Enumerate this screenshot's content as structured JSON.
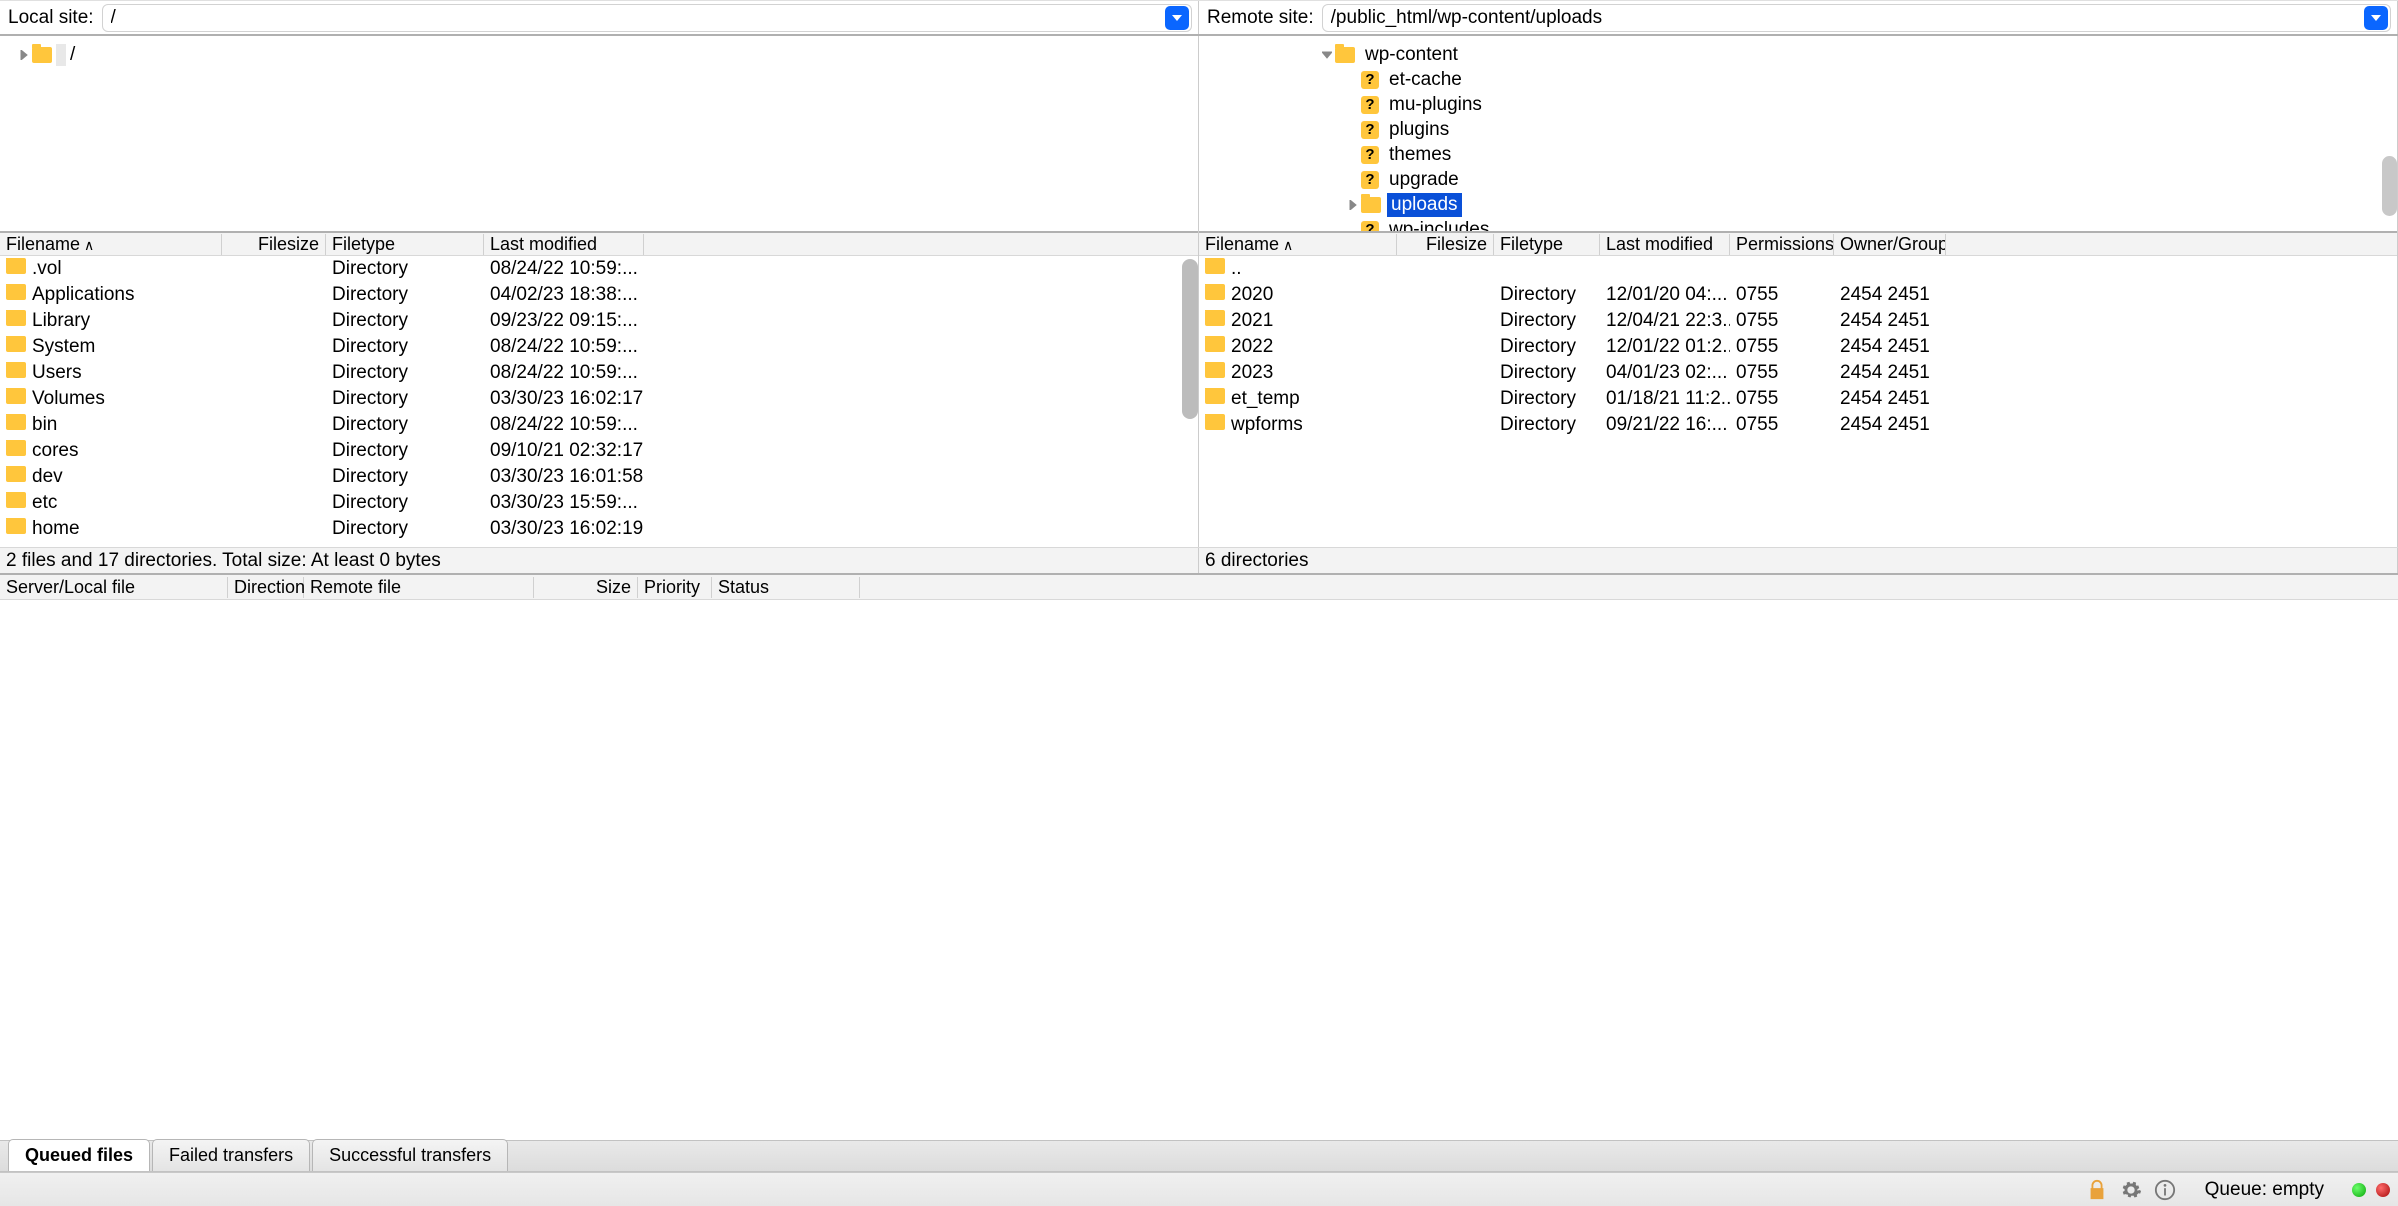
{
  "path_bar": {
    "local_label": "Local site:",
    "local_path": "/",
    "remote_label": "Remote site:",
    "remote_path": "/public_html/wp-content/uploads"
  },
  "local_tree": {
    "root_label": "/"
  },
  "remote_tree": {
    "parent": "wp-content",
    "children": [
      "et-cache",
      "mu-plugins",
      "plugins",
      "themes",
      "upgrade"
    ],
    "selected": "uploads",
    "trailing": "wp-includes"
  },
  "columns": {
    "filename": "Filename",
    "filesize": "Filesize",
    "filetype": "Filetype",
    "modified": "Last modified",
    "permissions": "Permissions",
    "owner": "Owner/Group"
  },
  "local_files": [
    {
      "name": ".vol",
      "type": "Directory",
      "mod": "08/24/22 10:59:..."
    },
    {
      "name": "Applications",
      "type": "Directory",
      "mod": "04/02/23 18:38:..."
    },
    {
      "name": "Library",
      "type": "Directory",
      "mod": "09/23/22 09:15:..."
    },
    {
      "name": "System",
      "type": "Directory",
      "mod": "08/24/22 10:59:..."
    },
    {
      "name": "Users",
      "type": "Directory",
      "mod": "08/24/22 10:59:..."
    },
    {
      "name": "Volumes",
      "type": "Directory",
      "mod": "03/30/23 16:02:17"
    },
    {
      "name": "bin",
      "type": "Directory",
      "mod": "08/24/22 10:59:..."
    },
    {
      "name": "cores",
      "type": "Directory",
      "mod": "09/10/21 02:32:17"
    },
    {
      "name": "dev",
      "type": "Directory",
      "mod": "03/30/23 16:01:58"
    },
    {
      "name": "etc",
      "type": "Directory",
      "mod": "03/30/23 15:59:..."
    },
    {
      "name": "home",
      "type": "Directory",
      "mod": "03/30/23 16:02:19"
    }
  ],
  "remote_files": [
    {
      "name": "..",
      "type": "",
      "mod": "",
      "perm": "",
      "own": ""
    },
    {
      "name": "2020",
      "type": "Directory",
      "mod": "12/01/20 04:...",
      "perm": "0755",
      "own": "2454 2451"
    },
    {
      "name": "2021",
      "type": "Directory",
      "mod": "12/04/21 22:3..",
      "perm": "0755",
      "own": "2454 2451"
    },
    {
      "name": "2022",
      "type": "Directory",
      "mod": "12/01/22 01:2...",
      "perm": "0755",
      "own": "2454 2451"
    },
    {
      "name": "2023",
      "type": "Directory",
      "mod": "04/01/23 02:...",
      "perm": "0755",
      "own": "2454 2451"
    },
    {
      "name": "et_temp",
      "type": "Directory",
      "mod": "01/18/21 11:2...",
      "perm": "0755",
      "own": "2454 2451"
    },
    {
      "name": "wpforms",
      "type": "Directory",
      "mod": "09/21/22 16:...",
      "perm": "0755",
      "own": "2454 2451"
    }
  ],
  "status": {
    "local": "2 files and 17 directories. Total size: At least 0 bytes",
    "remote": "6 directories"
  },
  "queue_columns": {
    "file": "Server/Local file",
    "direction": "Direction",
    "remote": "Remote file",
    "size": "Size",
    "priority": "Priority",
    "status": "Status"
  },
  "tabs": {
    "queued": "Queued files",
    "failed": "Failed transfers",
    "success": "Successful transfers"
  },
  "bottom": {
    "queue_label": "Queue: empty"
  }
}
